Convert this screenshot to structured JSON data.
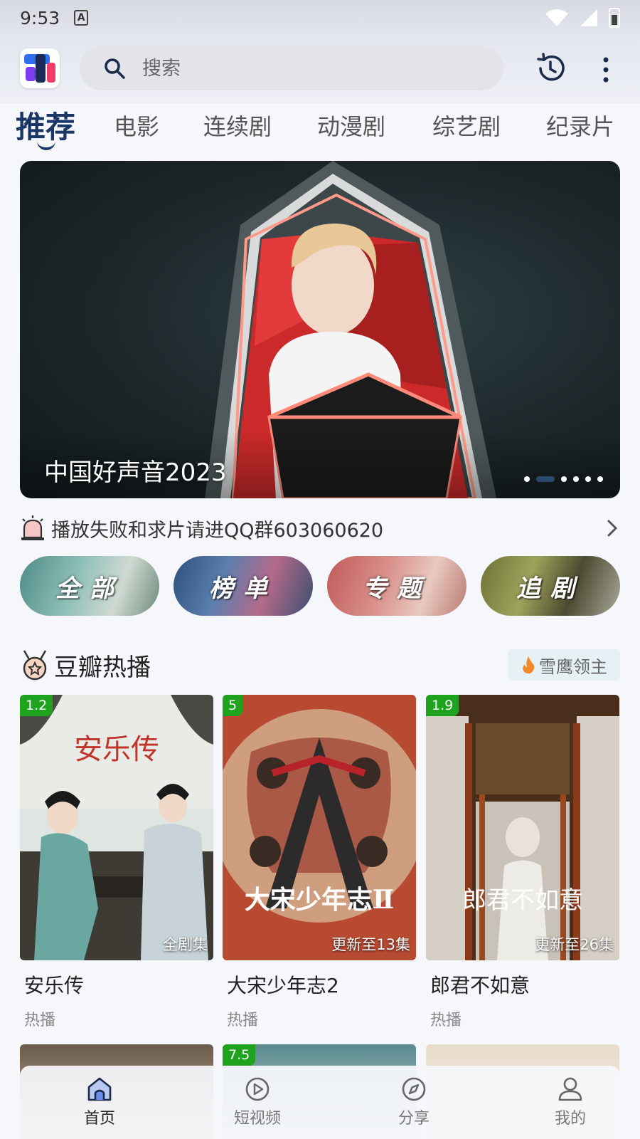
{
  "status_bar": {
    "time": "9:53",
    "a_badge": "A"
  },
  "search": {
    "placeholder": "搜索"
  },
  "tabs": [
    {
      "label": "推荐",
      "active": true
    },
    {
      "label": "电影"
    },
    {
      "label": "连续剧"
    },
    {
      "label": "动漫剧"
    },
    {
      "label": "综艺剧"
    },
    {
      "label": "纪录片"
    }
  ],
  "banner": {
    "title": "中国好声音2023",
    "dot_count": 6,
    "active_dot": 1
  },
  "notice": {
    "text": "播放失败和求片请进QQ群603060620"
  },
  "categories": [
    {
      "label": "全部"
    },
    {
      "label": "榜单"
    },
    {
      "label": "专题"
    },
    {
      "label": "追剧"
    }
  ],
  "section": {
    "title": "豆瓣热播",
    "tag": "雪鹰领主"
  },
  "cards": [
    {
      "score": "1.2",
      "episodes": "全剧集",
      "name": "安乐传",
      "status": "热播",
      "poster_text": "安乐传"
    },
    {
      "score": "5",
      "episodes": "更新至13集",
      "name": "大宋少年志2",
      "status": "热播",
      "poster_text": "大宋少年志Ⅱ"
    },
    {
      "score": "1.9",
      "episodes": "更新至26集",
      "name": "郎君不如意",
      "status": "热播",
      "poster_text": "郎君不如意"
    }
  ],
  "row2": [
    {
      "score": ""
    },
    {
      "score": "7.5"
    },
    {
      "score": ""
    }
  ],
  "bottom_nav": [
    {
      "label": "首页",
      "icon": "home-icon",
      "active": true
    },
    {
      "label": "短视频",
      "icon": "play-icon"
    },
    {
      "label": "分享",
      "icon": "compass-icon"
    },
    {
      "label": "我的",
      "icon": "user-icon"
    }
  ],
  "colors": {
    "accent": "#1a3666",
    "score_badge": "#1fa31f",
    "tag_bg": "#e6f1f5"
  }
}
